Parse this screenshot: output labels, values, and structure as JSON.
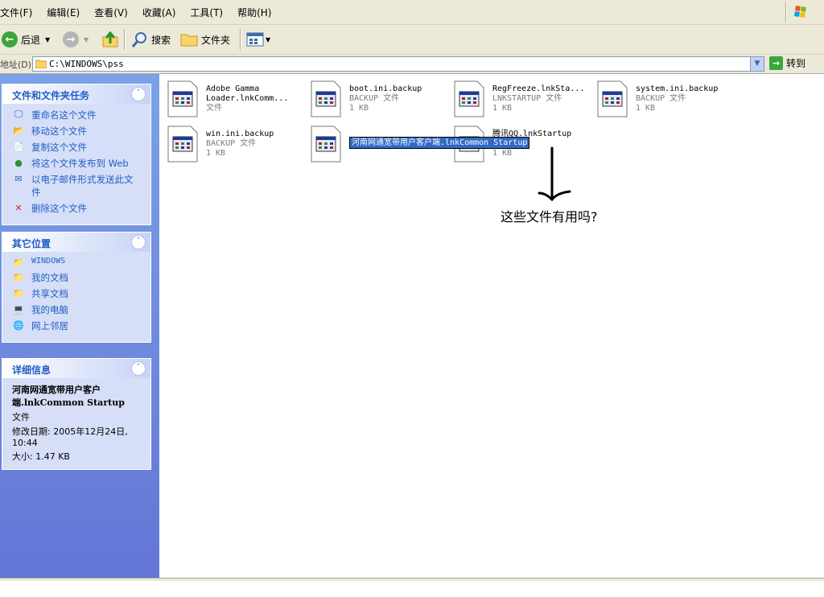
{
  "menu": [
    "文件(F)",
    "编辑(E)",
    "查看(V)",
    "收藏(A)",
    "工具(T)",
    "帮助(H)"
  ],
  "toolbar": {
    "back": "后退",
    "search": "搜索",
    "folders": "文件夹"
  },
  "address": {
    "label": "地址(D)",
    "path": "C:\\WINDOWS\\pss",
    "go": "转到"
  },
  "tasks": {
    "title": "文件和文件夹任务",
    "items": [
      "重命名这个文件",
      "移动这个文件",
      "复制这个文件",
      "将这个文件发布到 Web",
      "以电子邮件形式发送此文件",
      "删除这个文件"
    ]
  },
  "places": {
    "title": "其它位置",
    "items": [
      "WINDOWS",
      "我的文档",
      "共享文档",
      "我的电脑",
      "网上邻居"
    ]
  },
  "details": {
    "title": "详细信息",
    "name": "河南网通宽带用户客户端.lnkCommon Startup",
    "type": "文件",
    "modified": "修改日期: 2005年12月24日, 10:44",
    "size": "大小: 1.47 KB"
  },
  "files": [
    {
      "name": "Adobe Gamma Loader.lnkComm...",
      "type": "文件",
      "size": ""
    },
    {
      "name": "boot.ini.backup",
      "type": "BACKUP 文件",
      "size": "1 KB"
    },
    {
      "name": "RegFreeze.lnkSta...",
      "type": "LNKSTARTUP 文件",
      "size": "1 KB"
    },
    {
      "name": "system.ini.backup",
      "type": "BACKUP 文件",
      "size": "1 KB"
    },
    {
      "name": "win.ini.backup",
      "type": "BACKUP 文件",
      "size": "1 KB"
    },
    {
      "name": "",
      "type": "",
      "size": ""
    },
    {
      "name": "腾讯QQ.lnkStartup",
      "type": "文件",
      "size": "1 KB"
    }
  ],
  "rename_text": "河南网通宽带用户客户端.lnkCommon Startup",
  "annotation": "这些文件有用吗?"
}
